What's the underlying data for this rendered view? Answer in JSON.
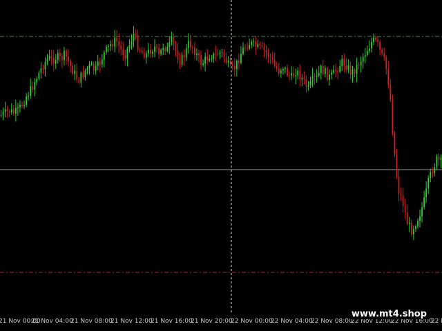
{
  "colors": {
    "background": "#000000",
    "bull": "#33cc33",
    "bear": "#cc2222",
    "bid_line": "#9a9a9a",
    "upper_level": "#4f7f4f",
    "lower_level": "#a03030",
    "crosshair": "#d8d8d8",
    "axis_text": "#c8c8c8"
  },
  "chart_data": {
    "type": "candlestick",
    "x_axis_ticks": [
      "21 Nov 00:00",
      "21 Nov 04:00",
      "21 Nov 08:00",
      "21 Nov 12:00",
      "21 Nov 16:00",
      "21 Nov 20:00",
      "22 Nov 00:00",
      "22 Nov 04:00",
      "22 Nov 08:00",
      "22 Nov 12:00",
      "22 Nov 16:00",
      "22 N"
    ],
    "grid": false,
    "close_path": [
      0.82,
      0.8,
      0.78,
      0.8,
      0.78,
      0.72,
      0.65,
      0.6,
      0.52,
      0.45,
      0.38,
      0.33,
      0.35,
      0.32,
      0.34,
      0.3,
      0.38,
      0.45,
      0.52,
      0.48,
      0.42,
      0.4,
      0.44,
      0.38,
      0.3,
      0.25,
      0.2,
      0.18,
      0.26,
      0.3,
      0.22,
      0.12,
      0.22,
      0.28,
      0.3,
      0.26,
      0.24,
      0.32,
      0.22,
      0.26,
      0.18,
      0.28,
      0.36,
      0.3,
      0.2,
      0.24,
      0.32,
      0.38,
      0.34,
      0.3,
      0.32,
      0.28,
      0.3,
      0.38,
      0.44,
      0.4,
      0.3,
      0.24,
      0.2,
      0.22,
      0.24,
      0.26,
      0.28,
      0.32,
      0.4,
      0.44,
      0.4,
      0.46,
      0.5,
      0.44,
      0.48,
      0.54,
      0.6,
      0.52,
      0.5,
      0.42,
      0.46,
      0.5,
      0.46,
      0.4,
      0.36,
      0.4,
      0.46,
      0.42,
      0.36,
      0.3,
      0.24,
      0.18,
      0.2,
      0.3,
      0.38,
      0.6,
      1.1,
      1.45,
      1.55,
      1.72,
      1.8,
      1.74,
      1.66,
      1.56,
      1.4,
      1.28,
      1.2,
      1.22
    ],
    "bid_level": 0.2,
    "upper_level": 0.97,
    "lower_level": 1.7
  },
  "watermark": "www.mt4.shop"
}
